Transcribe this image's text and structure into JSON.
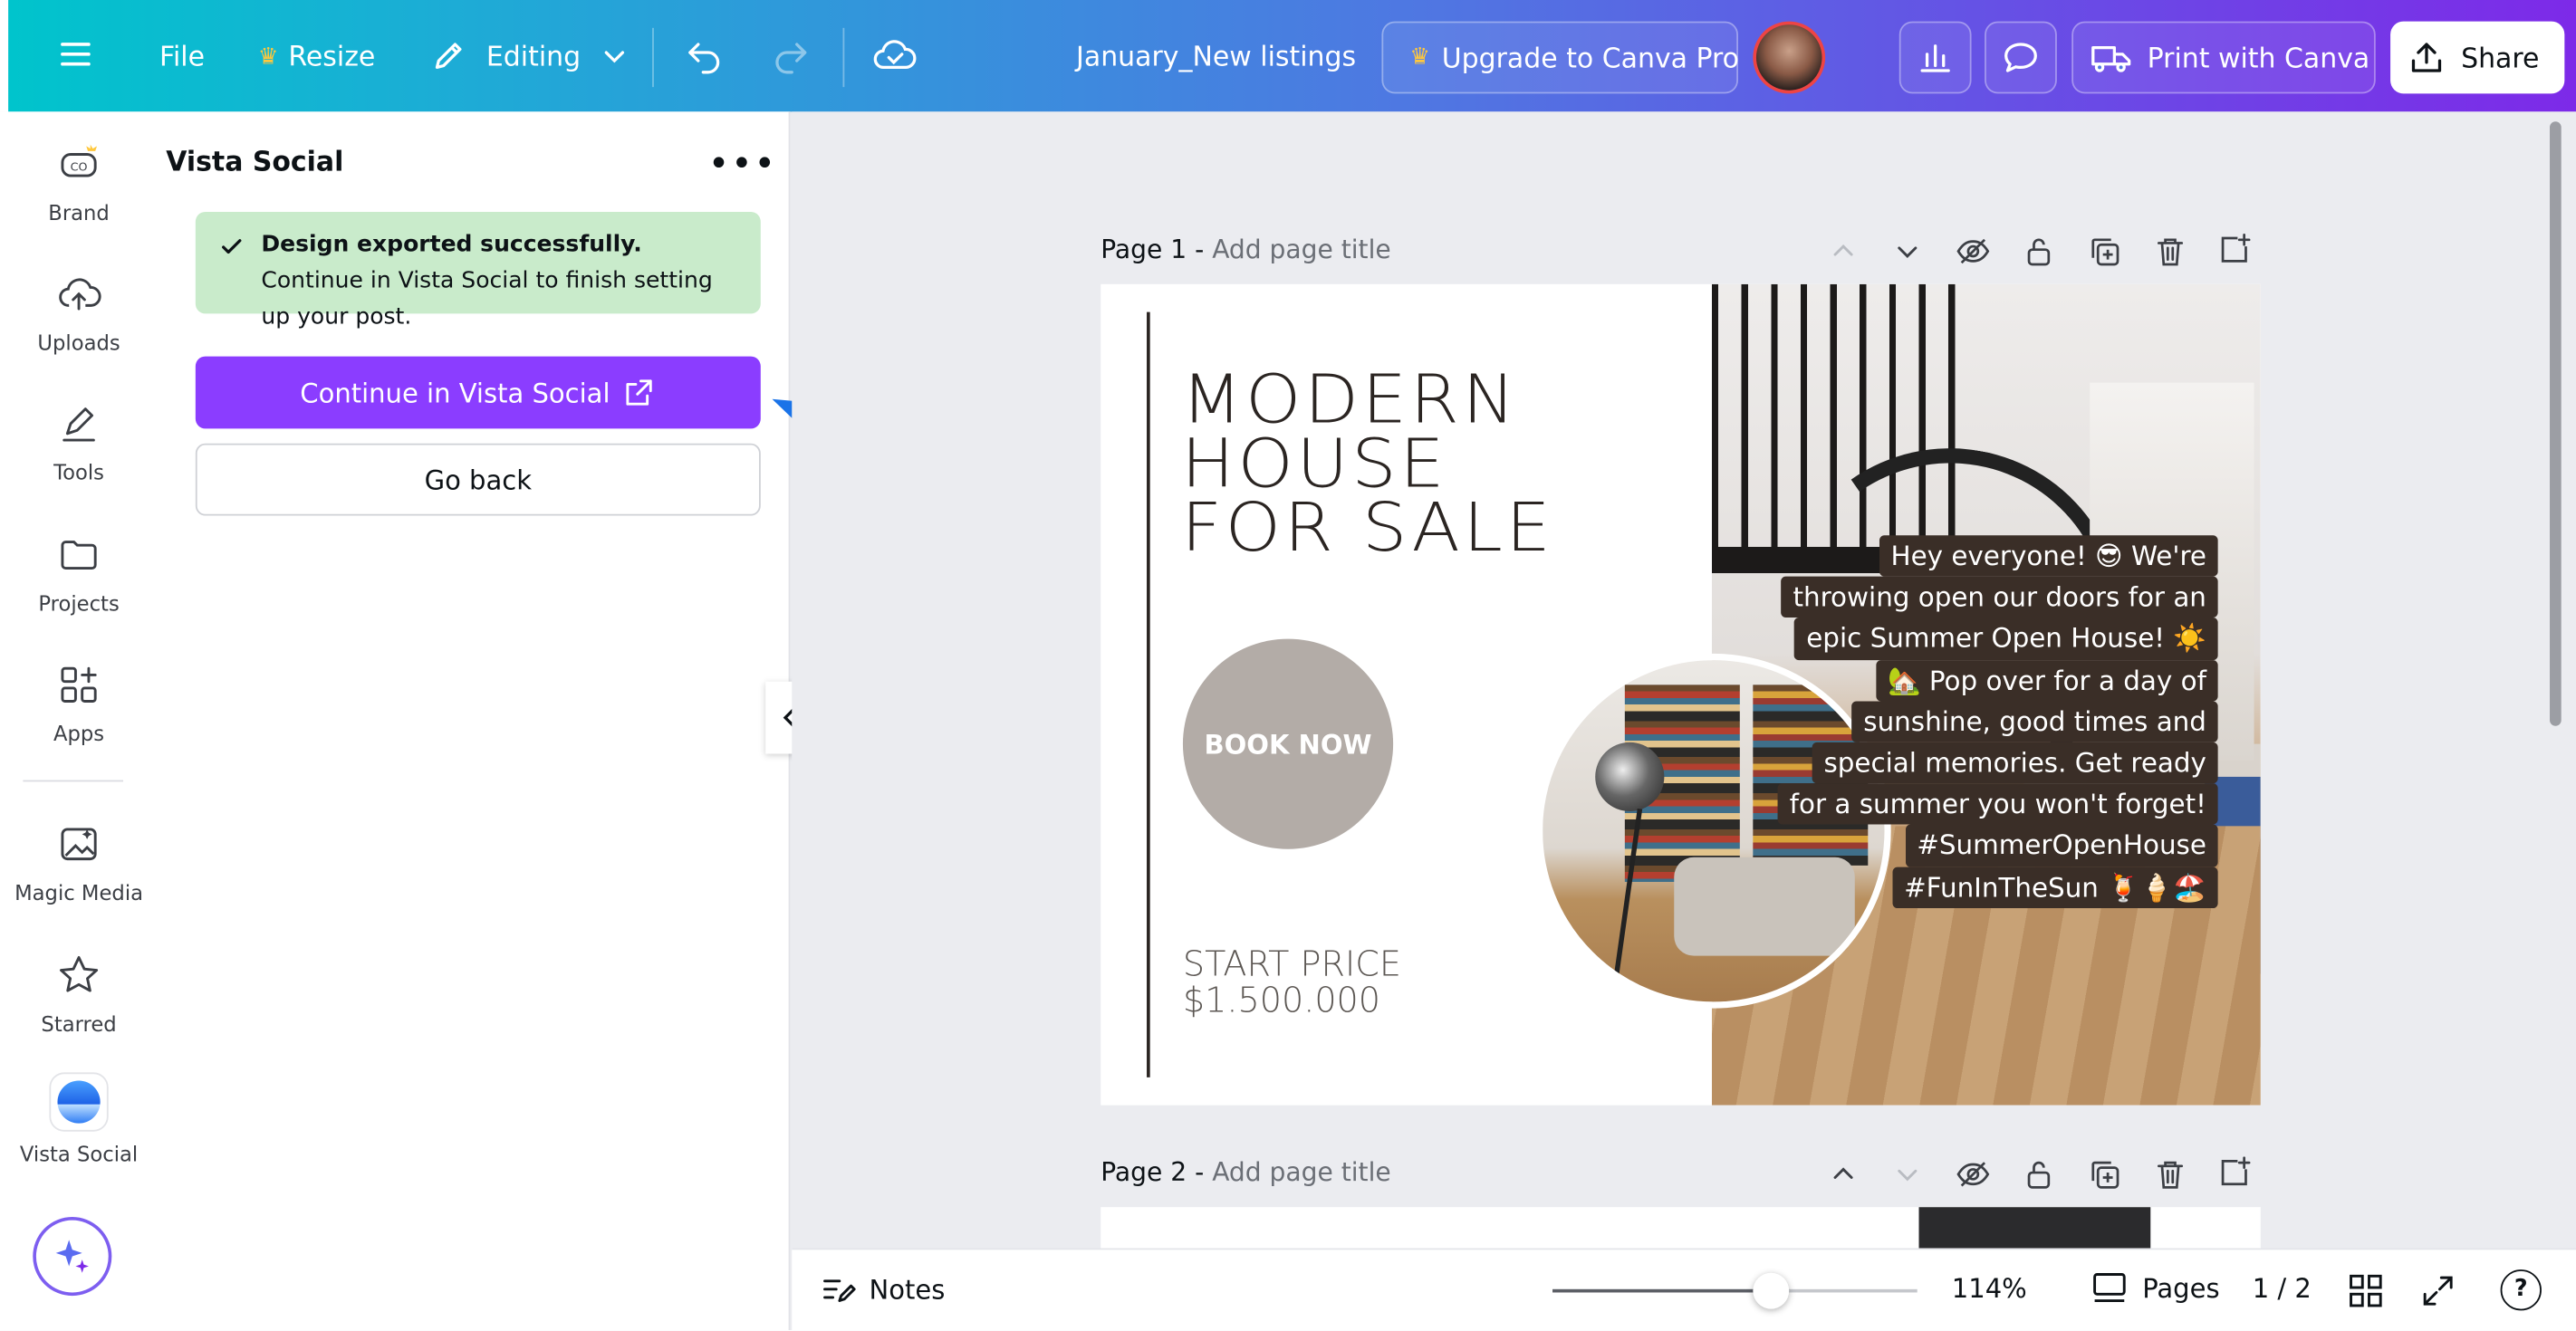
{
  "topbar": {
    "menu_icon": "hamburger-menu-icon",
    "file_label": "File",
    "resize_label": "Resize",
    "editing_label": "Editing",
    "doc_title": "January_New listings",
    "upgrade_label": "Upgrade to Canva Pro",
    "print_label": "Print with Canva",
    "share_label": "Share"
  },
  "rail": {
    "items": [
      {
        "label": "Brand",
        "icon": "brand-kit-icon"
      },
      {
        "label": "Uploads",
        "icon": "cloud-upload-icon"
      },
      {
        "label": "Tools",
        "icon": "pen-tool-icon"
      },
      {
        "label": "Projects",
        "icon": "folder-icon"
      },
      {
        "label": "Apps",
        "icon": "apps-grid-icon"
      },
      {
        "label": "Magic Media",
        "icon": "magic-media-icon"
      },
      {
        "label": "Starred",
        "icon": "star-icon"
      },
      {
        "label": "Vista Social",
        "icon": "vista-social-logo"
      }
    ]
  },
  "panel": {
    "title": "Vista Social",
    "success_bold": "Design exported successfully.",
    "success_text": " Continue in Vista Social to finish setting up your post.",
    "continue_label": "Continue in Vista Social",
    "goback_label": "Go back"
  },
  "pages": [
    {
      "label": "Page 1 -",
      "placeholder": "Add page title"
    },
    {
      "label": "Page 2 -",
      "placeholder": "Add page title"
    }
  ],
  "design": {
    "headline_1": "MODERN",
    "headline_2": "HOUSE",
    "headline_3": "FOR SALE",
    "book_now": "BOOK NOW",
    "start_price_label": "START PRICE",
    "price": "$1.500.000",
    "caption_lines": [
      "Hey everyone! 😎 We're",
      "throwing open our doors for an",
      "epic Summer Open House! ☀️",
      "🏡 Pop over for a day of",
      "sunshine, good times and",
      "special memories. Get ready",
      "for a summer you won't forget!",
      "#SummerOpenHouse",
      "#FunInTheSun 🍹🍦🏖️"
    ]
  },
  "bottombar": {
    "notes_label": "Notes",
    "zoom_label": "114%",
    "zoom_level": 0.6,
    "pages_label": "Pages",
    "page_count": "1 / 2"
  },
  "colors": {
    "accent_purple": "#7d2ae8",
    "button_purple": "#8b3dff",
    "success_bg": "#c9ebcb",
    "annotation_arrow": "#1a73e8"
  }
}
